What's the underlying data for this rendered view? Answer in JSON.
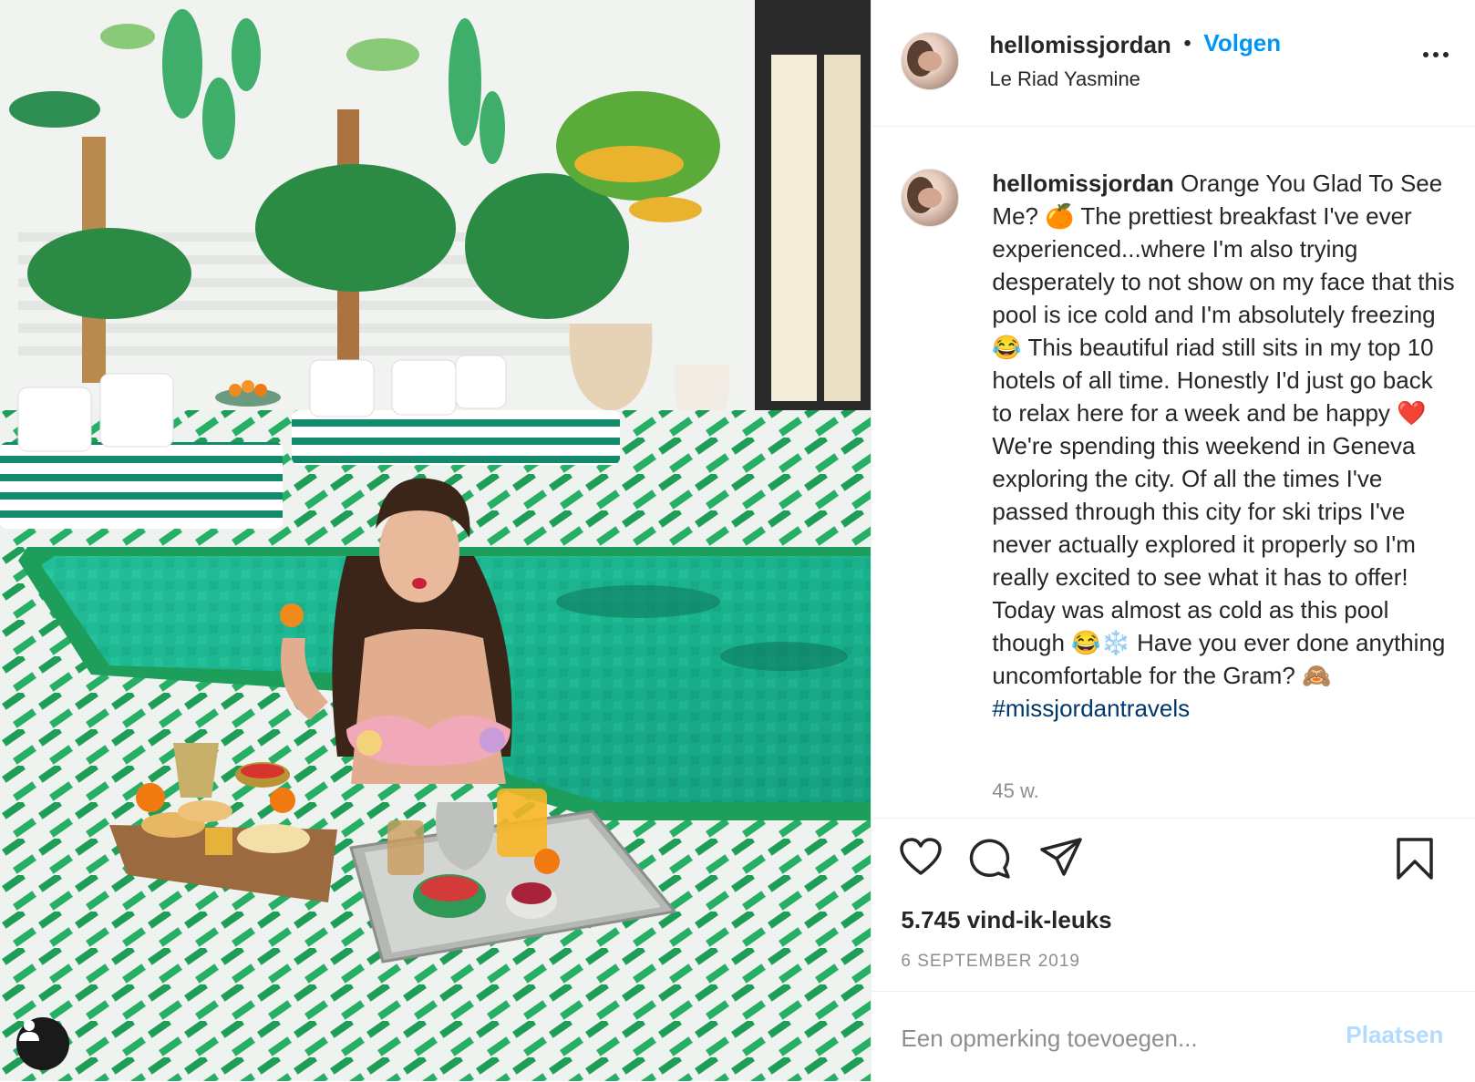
{
  "post": {
    "username": "hellomissjordan",
    "separator": "•",
    "follow_label": "Volgen",
    "location": "Le Riad Yasmine",
    "more_icon": "more-horizontal-icon"
  },
  "caption": {
    "username": "hellomissjordan",
    "text_1": " Orange You Glad To See Me? ",
    "emoji_1": "🍊",
    "text_2": " The prettiest breakfast I've ever experienced...where I'm also trying desperately to not show on my face that this pool is ice cold and I'm absolutely freezing ",
    "emoji_2": "😂",
    "text_3": " This beautiful riad still sits in my top 10 hotels of all time. Honestly I'd just go back to relax here for a week and be happy ",
    "emoji_3": "❤️",
    "text_4": " We're spending this weekend in Geneva exploring the city. Of all the times I've passed through this city for ski trips I've never actually explored it properly so I'm really excited to see what it has to offer! Today was almost as cold as this pool though ",
    "emoji_4": "😂❄️",
    "text_5": " Have you ever done anything uncomfortable for the Gram? ",
    "emoji_5": "🙈",
    "hashtag": "#missjordantravels",
    "time_ago": "45 w."
  },
  "actions": {
    "like_icon": "heart-icon",
    "comment_icon": "comment-icon",
    "share_icon": "send-icon",
    "save_icon": "bookmark-icon",
    "likes": "5.745 vind-ik-leuks",
    "date": "6 SEPTEMBER 2019"
  },
  "comment": {
    "placeholder": "Een opmerking toevoegen...",
    "post_label": "Plaatsen"
  },
  "colors": {
    "accent": "#0095f6",
    "hashtag": "#00376b",
    "post_disabled": "#b3dbff",
    "pool": "#1fb58f",
    "tile_green": "#17a35c"
  }
}
